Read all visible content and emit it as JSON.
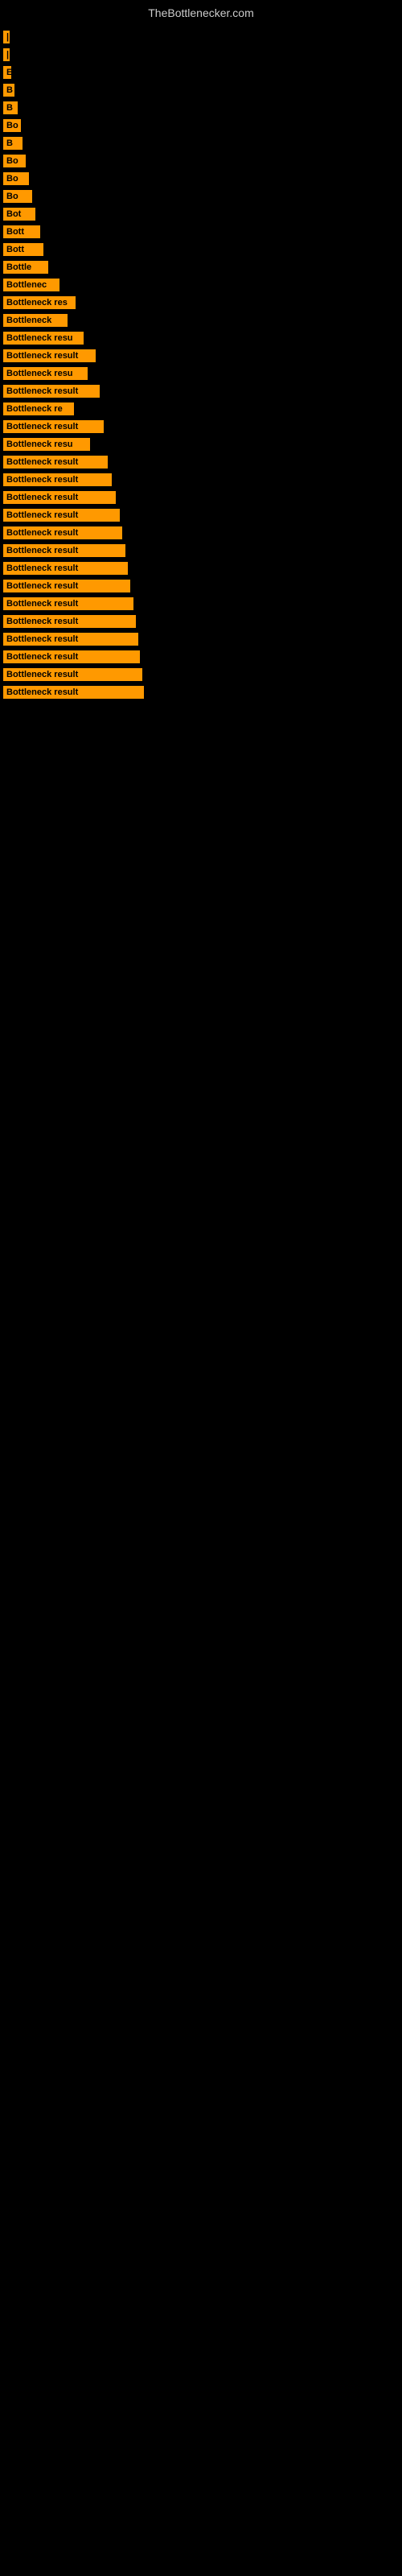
{
  "site": {
    "title": "TheBottlenecker.com"
  },
  "bars": [
    {
      "label": "|",
      "width": 4
    },
    {
      "label": "|",
      "width": 6
    },
    {
      "label": "E",
      "width": 10
    },
    {
      "label": "B",
      "width": 14
    },
    {
      "label": "B",
      "width": 18
    },
    {
      "label": "Bo",
      "width": 22
    },
    {
      "label": "B",
      "width": 24
    },
    {
      "label": "Bo",
      "width": 28
    },
    {
      "label": "Bo",
      "width": 32
    },
    {
      "label": "Bo",
      "width": 36
    },
    {
      "label": "Bot",
      "width": 40
    },
    {
      "label": "Bott",
      "width": 46
    },
    {
      "label": "Bott",
      "width": 50
    },
    {
      "label": "Bottle",
      "width": 56
    },
    {
      "label": "Bottlenec",
      "width": 70
    },
    {
      "label": "Bottleneck res",
      "width": 90
    },
    {
      "label": "Bottleneck",
      "width": 80
    },
    {
      "label": "Bottleneck resu",
      "width": 100
    },
    {
      "label": "Bottleneck result",
      "width": 115
    },
    {
      "label": "Bottleneck resu",
      "width": 105
    },
    {
      "label": "Bottleneck result",
      "width": 120
    },
    {
      "label": "Bottleneck re",
      "width": 88
    },
    {
      "label": "Bottleneck result",
      "width": 125
    },
    {
      "label": "Bottleneck resu",
      "width": 108
    },
    {
      "label": "Bottleneck result",
      "width": 130
    },
    {
      "label": "Bottleneck result",
      "width": 135
    },
    {
      "label": "Bottleneck result",
      "width": 140
    },
    {
      "label": "Bottleneck result",
      "width": 145
    },
    {
      "label": "Bottleneck result",
      "width": 148
    },
    {
      "label": "Bottleneck result",
      "width": 152
    },
    {
      "label": "Bottleneck result",
      "width": 155
    },
    {
      "label": "Bottleneck result",
      "width": 158
    },
    {
      "label": "Bottleneck result",
      "width": 162
    },
    {
      "label": "Bottleneck result",
      "width": 165
    },
    {
      "label": "Bottleneck result",
      "width": 168
    },
    {
      "label": "Bottleneck result",
      "width": 170
    },
    {
      "label": "Bottleneck result",
      "width": 173
    },
    {
      "label": "Bottleneck result",
      "width": 175
    }
  ]
}
